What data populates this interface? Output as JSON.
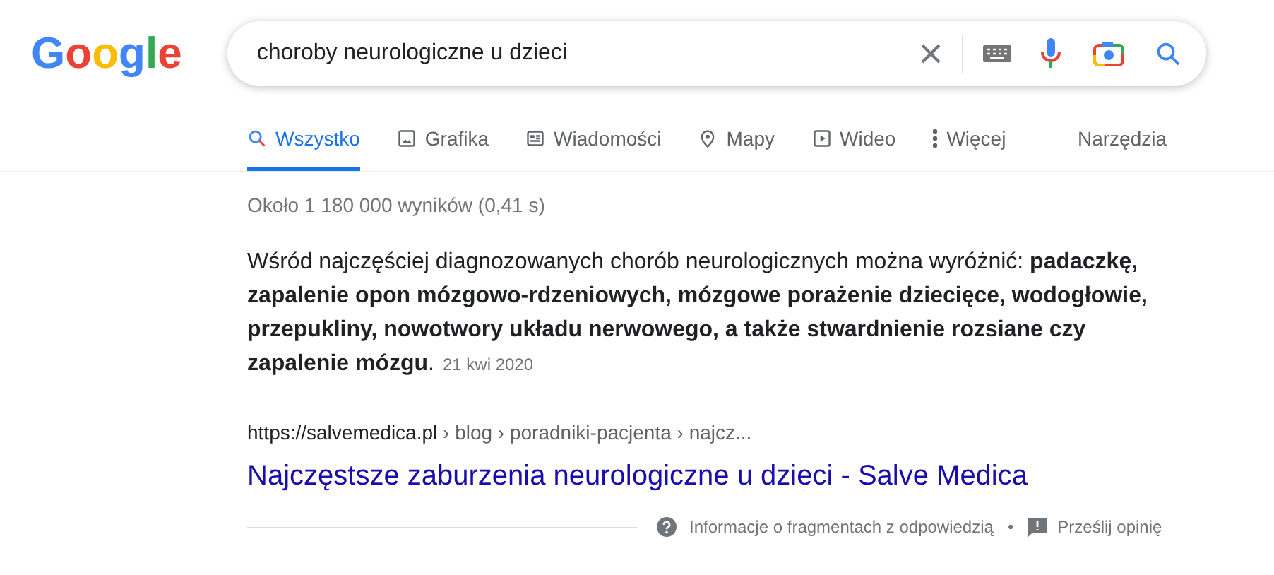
{
  "logo": {
    "text": "Google"
  },
  "search": {
    "value": "choroby neurologiczne u dzieci"
  },
  "tabs": [
    {
      "kind": "all",
      "label": "Wszystko",
      "selected": true
    },
    {
      "kind": "images",
      "label": "Grafika",
      "selected": false
    },
    {
      "kind": "news",
      "label": "Wiadomości",
      "selected": false
    },
    {
      "kind": "maps",
      "label": "Mapy",
      "selected": false
    },
    {
      "kind": "video",
      "label": "Wideo",
      "selected": false
    },
    {
      "kind": "more",
      "label": "Więcej",
      "selected": false
    }
  ],
  "tools": "Narzędzia",
  "result_stats": "Około 1 180 000 wyników (0,41 s)",
  "featured_snippet": {
    "text": "Wśród najczęściej diagnozowanych chorób neurologicznych można wyróżnić: **padaczkę, zapalenie opon mózgowo-rdzeniowych, mózgowe porażenie dziecięce, wodogłowie, przepukliny, nowotwory układu nerwowego, a także stwardnienie rozsiane czy zapalenie mózgu**.",
    "date": "21 kwi 2020",
    "url_host": "https://salvemedica.pl",
    "url_path": " › blog › poradniki-pacjenta › najcz...",
    "title": "Najczęstsze zaburzenia neurologiczne u dzieci - Salve Medica",
    "about": "Informacje o fragmentach z odpowiedzią",
    "separator": "•",
    "feedback": "Prześlij opinię"
  }
}
